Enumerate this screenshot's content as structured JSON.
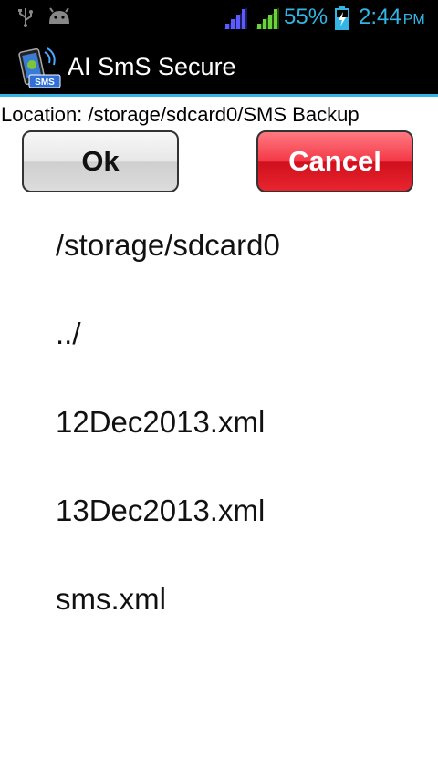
{
  "status_bar": {
    "battery_percent": "55%",
    "time": "2:44",
    "ampm": "PM",
    "icons": [
      "usb-icon",
      "android-debug-icon",
      "signal-icon",
      "signal-icon",
      "battery-charging-icon"
    ]
  },
  "app": {
    "title": "AI SmS Secure",
    "icon_badge": "SMS"
  },
  "location": "Location: /storage/sdcard0/SMS Backup",
  "buttons": {
    "ok": "Ok",
    "cancel": "Cancel"
  },
  "files": [
    "/storage/sdcard0",
    "../",
    "12Dec2013.xml",
    "13Dec2013.xml",
    "sms.xml"
  ],
  "colors": {
    "accent": "#33b5e5",
    "cancel_red": "#e8252f"
  }
}
